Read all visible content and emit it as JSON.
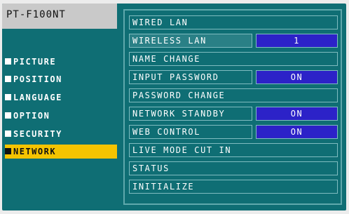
{
  "model": "PT-F100NT",
  "left_menu": [
    {
      "label": "PICTURE",
      "active": false
    },
    {
      "label": "POSITION",
      "active": false
    },
    {
      "label": "LANGUAGE",
      "active": false
    },
    {
      "label": "OPTION",
      "active": false
    },
    {
      "label": "SECURITY",
      "active": false
    },
    {
      "label": "NETWORK",
      "active": true
    }
  ],
  "network_menu": [
    {
      "label": "WIRED LAN",
      "value": null
    },
    {
      "label": "WIRELESS LAN",
      "value": "1"
    },
    {
      "label": "NAME CHANGE",
      "value": null
    },
    {
      "label": "INPUT PASSWORD",
      "value": "ON"
    },
    {
      "label": "PASSWORD CHANGE",
      "value": null
    },
    {
      "label": "NETWORK STANDBY",
      "value": "ON"
    },
    {
      "label": "WEB CONTROL",
      "value": "ON"
    },
    {
      "label": "LIVE MODE CUT IN",
      "value": null
    },
    {
      "label": "STATUS",
      "value": null
    },
    {
      "label": "INITIALIZE",
      "value": null
    }
  ],
  "colors": {
    "background": "#0f6e74",
    "highlight": "#f5c400",
    "value_box": "#2c22c8"
  }
}
